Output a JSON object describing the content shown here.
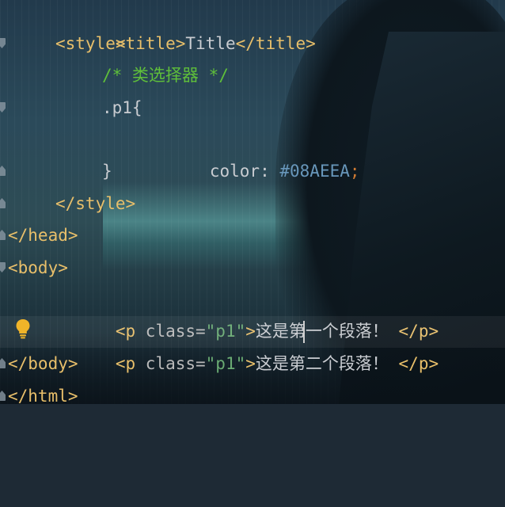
{
  "lines": [
    {
      "indent": "    ",
      "tag_open": "<title>",
      "text": "Title",
      "tag_close": "</title>"
    },
    {
      "indent": "    ",
      "tag": "<style>"
    },
    {
      "indent": "        ",
      "comment": "/* 类选择器 */"
    },
    {
      "indent": "        ",
      "selector": ".p1{"
    },
    {
      "indent": "            ",
      "property": "color: ",
      "value": "#08AEEA",
      "semicolon": ";"
    },
    {
      "indent": "        ",
      "brace": "}"
    },
    {
      "indent": "    ",
      "tag": "</style>"
    },
    {
      "indent": "",
      "tag": "</head>"
    },
    {
      "indent": "",
      "tag": "<body>"
    },
    {
      "indent": "    ",
      "p_open": "<p ",
      "attr": "class=",
      "attr_value": "\"p1\"",
      "p_gt": ">",
      "text": "这是第一个段落！",
      "p_close": " </p>"
    },
    {
      "indent": "    ",
      "p_open": "<p ",
      "attr": "class=",
      "attr_value": "\"p1\"",
      "p_gt": ">",
      "text": "这是第二个段落！",
      "p_close": " </p>"
    },
    {
      "indent": "",
      "tag": "</body>"
    },
    {
      "indent": "",
      "tag": "</html>"
    }
  ],
  "colors": {
    "tag": "#e8bf6a",
    "string": "#6aab73",
    "comment": "#5fbf3a",
    "number_value": "#6897bb",
    "text": "#c9ccd1",
    "bulb": "#f0b429"
  },
  "icons": [
    "intention-bulb-icon",
    "fold-marker-icon"
  ]
}
